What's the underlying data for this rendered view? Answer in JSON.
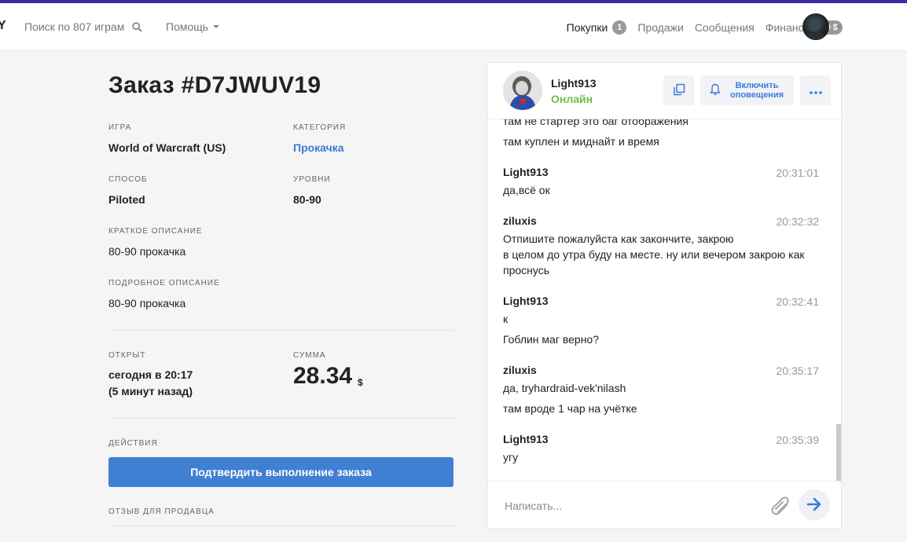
{
  "nav": {
    "logo_fragment": "Y",
    "search_placeholder": "Поиск по 807 играм",
    "help_label": "Помощь",
    "links": [
      {
        "label": "Покупки",
        "badge": "1"
      },
      {
        "label": "Продажи"
      },
      {
        "label": "Сообщения"
      },
      {
        "label": "Финансы",
        "badge": "10 $"
      }
    ]
  },
  "order": {
    "title": "Заказ #D7JWUV19",
    "game_label": "ИГРА",
    "game_value": "World of Warcraft (US)",
    "category_label": "КАТЕГОРИЯ",
    "category_value": "Прокачка",
    "method_label": "СПОСОБ",
    "method_value": "Piloted",
    "levels_label": "УРОВНИ",
    "levels_value": "80-90",
    "short_desc_label": "КРАТКОЕ ОПИСАНИЕ",
    "short_desc_value": "80-90 прокачка",
    "full_desc_label": "ПОДРОБНОЕ ОПИСАНИЕ",
    "full_desc_value": "80-90 прокачка",
    "opened_label": "ОТКРЫТ",
    "opened_value_line1": "сегодня в 20:17",
    "opened_value_line2": "(5 минут назад)",
    "sum_label": "СУММА",
    "sum_value": "28.34",
    "sum_currency": "$",
    "actions_label": "ДЕЙСТВИЯ",
    "confirm_button": "Подтвердить выполнение заказа",
    "review_label": "ОТЗЫВ ДЛЯ ПРОДАВЦА"
  },
  "chat": {
    "user_name": "Light913",
    "status": "Онлайн",
    "notify_button": "Включить оповещения",
    "input_placeholder": "Написать...",
    "messages": [
      {
        "lines": [
          "там не стартер это баг отображения",
          "там куплен и миднайт и время"
        ]
      },
      {
        "author": "Light913",
        "time": "20:31:01",
        "lines": [
          "да,всё ок"
        ]
      },
      {
        "author": "ziluxis",
        "time": "20:32:32",
        "lines": [
          "Отпишите пожалуйста как закончите, закрою",
          "в целом до утра буду на месте. ну или вечером закрою как",
          "проснусь"
        ]
      },
      {
        "author": "Light913",
        "time": "20:32:41",
        "lines": [
          "к",
          "Гоблин маг верно?"
        ]
      },
      {
        "author": "ziluxis",
        "time": "20:35:17",
        "lines": [
          "да, tryhardraid-vek'nilash",
          "там вроде 1 чар на учётке"
        ]
      },
      {
        "author": "Light913",
        "time": "20:35:39",
        "lines": [
          "угу"
        ]
      }
    ]
  },
  "colors": {
    "accent": "#4080d3",
    "online": "#6cc04a",
    "top_stripe": "#3a2ca6",
    "badge": "#999999"
  },
  "icons": [
    "search-icon",
    "caret-down-icon",
    "copy-icon",
    "bell-icon",
    "more-dots-icon",
    "paperclip-icon",
    "send-arrow-icon"
  ]
}
